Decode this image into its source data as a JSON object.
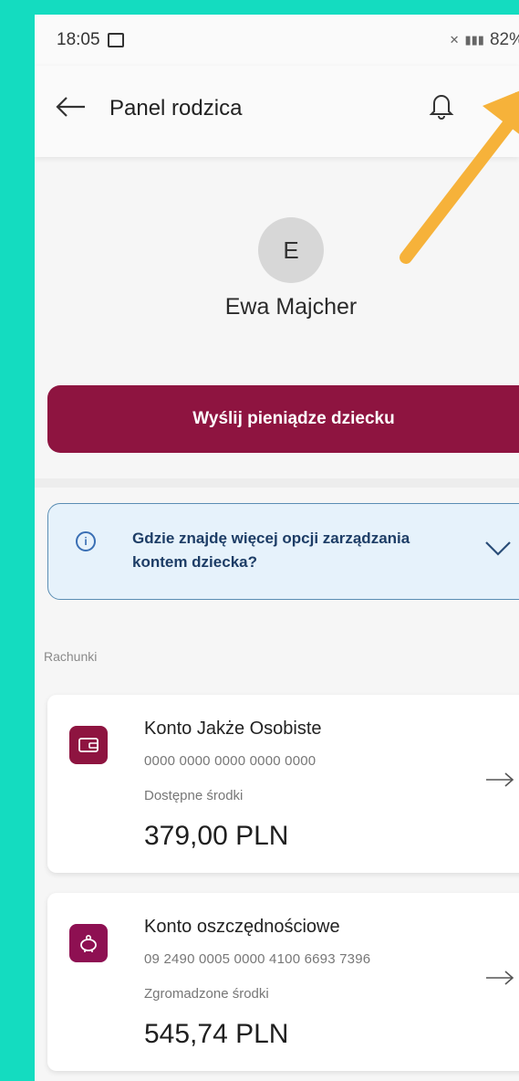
{
  "status_bar": {
    "time": "18:05",
    "battery": "82%"
  },
  "app_bar": {
    "title": "Panel rodzica"
  },
  "child": {
    "avatar_initial": "E",
    "name": "Ewa Majcher"
  },
  "send_button": {
    "label": "Wyślij pieniądze dziecku"
  },
  "info_box": {
    "text": "Gdzie znajdę więcej opcji zarządzania kontem dziecka?"
  },
  "accounts_section": {
    "label": "Rachunki",
    "accounts": [
      {
        "name": "Konto Jakże Osobiste",
        "number": "0000 0000 0000 0000 0000",
        "balance_label": "Dostępne środki",
        "amount": "379,00 PLN",
        "icon": "wallet-icon",
        "color": "#8e1440"
      },
      {
        "name": "Konto oszczędnościowe",
        "number": "09 2490 0005 0000 4100 6693 7396",
        "balance_label": "Zgromadzone środki",
        "amount": "545,74 PLN",
        "icon": "piggy-bank-icon",
        "color": "#8e1052"
      }
    ]
  },
  "colors": {
    "background": "#14dcc0",
    "brand": "#8e1440",
    "annotation": "#f6b23a",
    "info_bg": "#e6f2fb"
  }
}
